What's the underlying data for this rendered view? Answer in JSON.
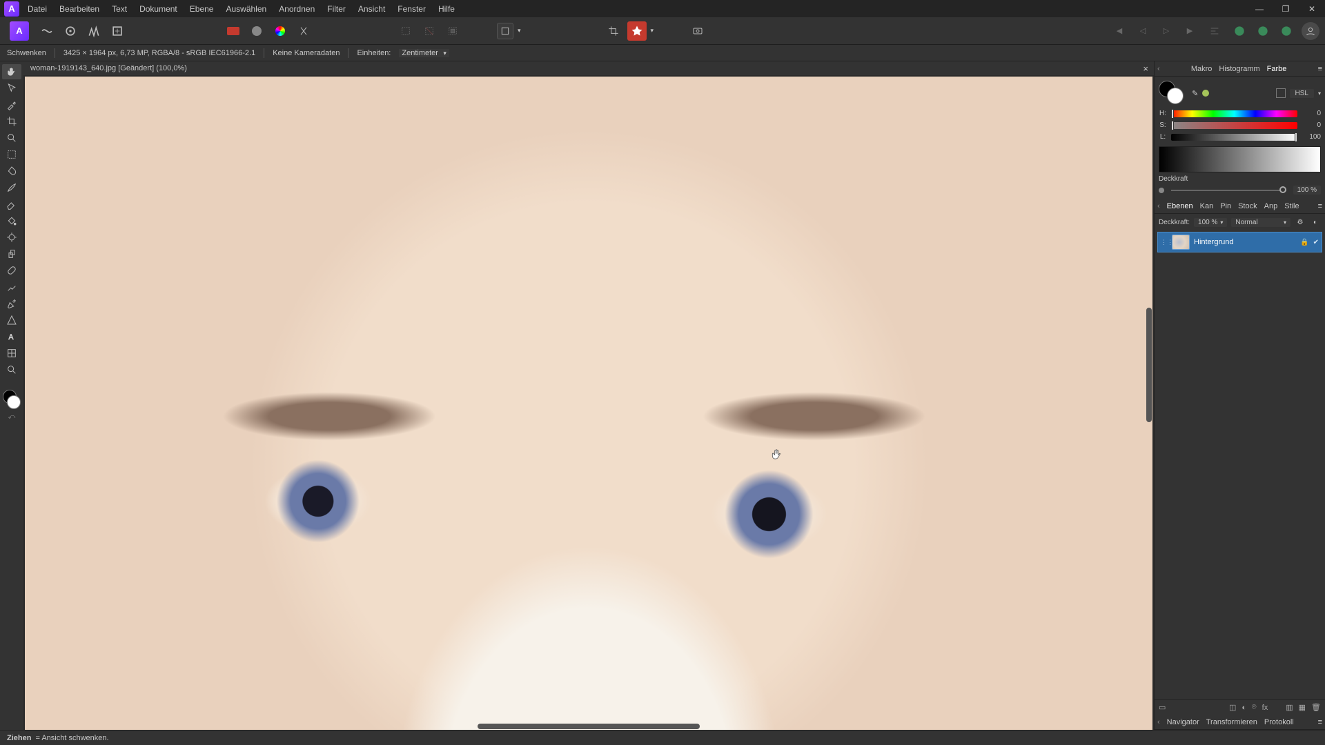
{
  "menu": [
    "Datei",
    "Bearbeiten",
    "Text",
    "Dokument",
    "Ebene",
    "Auswählen",
    "Anordnen",
    "Filter",
    "Ansicht",
    "Fenster",
    "Hilfe"
  ],
  "contextbar": {
    "tool": "Schwenken",
    "dims": "3425 × 1964 px, 6,73 MP, RGBA/8 - sRGB IEC61966-2.1",
    "camera": "Keine Kameradaten",
    "units_label": "Einheiten:",
    "units_value": "Zentimeter"
  },
  "doc_tab": "woman-1919143_640.jpg [Geändert] (100,0%)",
  "right_tabs_top": [
    "Makro",
    "Histogramm",
    "Farbe"
  ],
  "color_panel": {
    "model": "HSL",
    "h_label": "H:",
    "h_val": "0",
    "s_label": "S:",
    "s_val": "0",
    "l_label": "L:",
    "l_val": "100",
    "opacity_label": "Deckkraft",
    "opacity_val": "100 %"
  },
  "right_tabs_mid": [
    "Ebenen",
    "Kan",
    "Pin",
    "Stock",
    "Anp",
    "Stile"
  ],
  "layers_head": {
    "label": "Deckkraft:",
    "opacity": "100 %",
    "blend": "Normal"
  },
  "layer_name": "Hintergrund",
  "right_tabs_bottom": [
    "Navigator",
    "Transformieren",
    "Protokoll"
  ],
  "statusbar": {
    "bold": "Ziehen",
    "rest": " = Ansicht schwenken."
  }
}
